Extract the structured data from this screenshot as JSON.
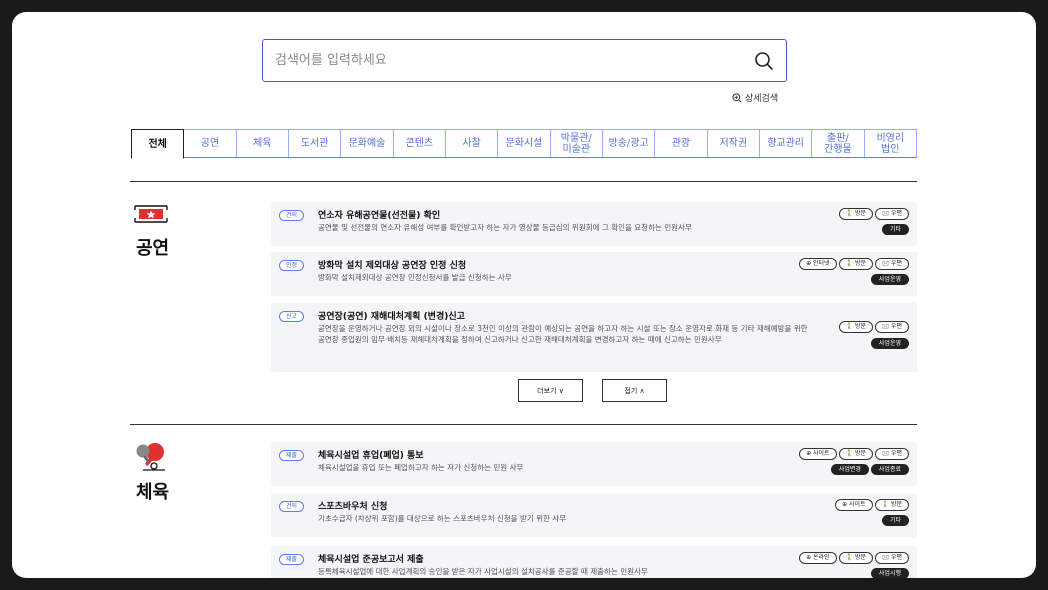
{
  "search": {
    "placeholder": "검색어를 입력하세요",
    "advanced_label": "상세검색"
  },
  "tabs": [
    {
      "label": "전체",
      "active": true
    },
    {
      "label": "공연"
    },
    {
      "label": "체육"
    },
    {
      "label": "도서관"
    },
    {
      "label": "문화예술"
    },
    {
      "label": "콘텐츠"
    },
    {
      "label": "사찰"
    },
    {
      "label": "문화시설"
    },
    {
      "label": "박물관/\n미술관"
    },
    {
      "label": "방송/광고"
    },
    {
      "label": "관광"
    },
    {
      "label": "저작권"
    },
    {
      "label": "향교관리"
    },
    {
      "label": "출판/\n간행물"
    },
    {
      "label": "비영리\n법인"
    }
  ],
  "sections": [
    {
      "title": "공연",
      "cards": [
        {
          "badge": "건의",
          "title": "연소자 유해공연물(선전물) 확인",
          "desc": "공연물 및 선전물의 연소자 유해성 여부를 확인받고자 하는 자가 영상물 등급심의 위원회에 그 확인을 요청하는 민원사무",
          "methods": [
            "방문",
            "우편"
          ],
          "tags": [
            "기타"
          ]
        },
        {
          "badge": "인정",
          "title": "방화막 설치 제외대상 공연장 인정 신청",
          "desc": "방화막 설치제외대상 공연장 인정신청서를 발급 신청하는 사무",
          "methods": [
            "인터넷",
            "방문",
            "우편"
          ],
          "tags": [
            "사업운영"
          ]
        },
        {
          "badge": "신고",
          "title": "공연장(공연) 재해대처계획 (변경)신고",
          "desc": "공연장을 운영하거나 공연장 외의 시설이나 장소로 3천인 이상의 관람이 예상되는 공연을 하고자 하는 시설 또는 장소 운영자로 화재 등 기타 재해예방을 위한 공연장 종업원의 임무·배치등 재해대처계획을 정하여 신고하거나 신고한 재해대처계획을 변경하고자 하는 때에 신고하는 민원사무",
          "methods": [
            "방문",
            "우편"
          ],
          "tags": [
            "사업운영"
          ]
        }
      ],
      "more_label": "더보기",
      "fold_label": "접기"
    },
    {
      "title": "체육",
      "cards": [
        {
          "badge": "제출",
          "title": "체육시설업 휴업(폐업) 통보",
          "desc": "체육시설업을 휴업 또는 폐업하고자 하는 자가 신청하는 민원 사무",
          "methods": [
            "사이트",
            "방문",
            "우편"
          ],
          "tags": [
            "사업변경",
            "사업종료"
          ]
        },
        {
          "badge": "건의",
          "title": "스포츠바우처 신청",
          "desc": "기초수급자 (차상위 포함)를 대상으로 하는 스포츠바우처 신청을 받기 위한 사무",
          "methods": [
            "사이트",
            "방문"
          ],
          "tags": [
            "기타"
          ]
        },
        {
          "badge": "제출",
          "title": "체육시설업 준공보고서 제출",
          "desc": "등록체육시설업에 대한 사업계획의 승인을 받은 자가 사업시설의 설치공사를 준공할 때 제출하는 민원사무",
          "methods": [
            "온라인",
            "방문",
            "우편"
          ],
          "tags": [
            "사업시행"
          ]
        }
      ]
    }
  ],
  "colors": {
    "accent": "#3b5bdb",
    "tab_text": "#5c6fd6",
    "card_bg": "#f4f5f7",
    "tag_bg": "#222222",
    "icon_red": "#e03131"
  },
  "icons": {
    "search": "search-icon",
    "zoom": "zoom-in-icon",
    "ticket": "ticket-icon",
    "pingpong": "ping-pong-icon"
  }
}
